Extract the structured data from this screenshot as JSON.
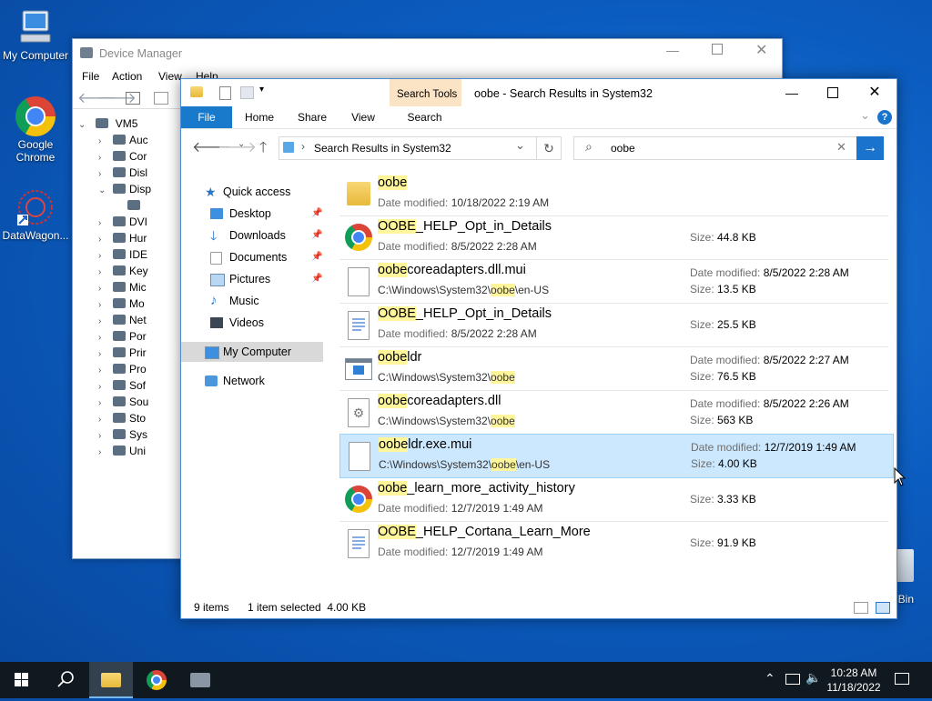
{
  "desktop": {
    "icons": [
      {
        "label": "My Computer"
      },
      {
        "label": "Google Chrome"
      },
      {
        "label": "DataWagon..."
      },
      {
        "label": "Bin"
      }
    ]
  },
  "device_manager": {
    "title": "Device Manager",
    "menu": [
      "File",
      "Action",
      "View",
      "Help"
    ],
    "tree_root": "VM5",
    "tree_items": [
      "Auc",
      "Cor",
      "Disl",
      "Disp",
      "",
      "DVI",
      "Hur",
      "IDE",
      "Key",
      "Mic",
      "Mo",
      "Net",
      "Por",
      "Prir",
      "Pro",
      "Sof",
      "Sou",
      "Sto",
      "Sys",
      "Uni"
    ]
  },
  "explorer": {
    "title": "oobe - Search Results in System32",
    "search_tools_label": "Search Tools",
    "tabs": {
      "file": "File",
      "home": "Home",
      "share": "Share",
      "view": "View",
      "search": "Search"
    },
    "address": "Search Results in System32",
    "search_query": "oobe",
    "nav": {
      "quick_access": "Quick access",
      "items": [
        "Desktop",
        "Downloads",
        "Documents",
        "Pictures",
        "Music",
        "Videos"
      ],
      "my_computer": "My Computer",
      "network": "Network"
    },
    "files": [
      {
        "hl": "oobe",
        "rest": "",
        "line2_key": "Date modified: ",
        "line2_val": "10/18/2022 2:19 AM",
        "icon": "folder-icon"
      },
      {
        "hl": "OOBE",
        "rest": "_HELP_Opt_in_Details",
        "line2_key": "Date modified: ",
        "line2_val": "8/5/2022 2:28 AM",
        "size_key": "Size: ",
        "size": "44.8 KB",
        "icon": "chrome-html-icon"
      },
      {
        "hl": "oobe",
        "rest": "coreadapters.dll.mui",
        "path_a": "C:\\Windows\\System32\\",
        "path_hl": "oobe",
        "path_b": "\\en-US",
        "date_key": "Date modified: ",
        "date": "8/5/2022 2:28 AM",
        "size_key": "Size: ",
        "size": "13.5 KB",
        "icon": "file-icon"
      },
      {
        "hl": "OOBE",
        "rest": "_HELP_Opt_in_Details",
        "line2_key": "Date modified: ",
        "line2_val": "8/5/2022 2:28 AM",
        "size_key": "Size: ",
        "size": "25.5 KB",
        "icon": "text-document-icon"
      },
      {
        "hl": "oobe",
        "rest": "ldr",
        "path_a": "C:\\Windows\\System32\\",
        "path_hl": "oobe",
        "path_b": "",
        "date_key": "Date modified: ",
        "date": "8/5/2022 2:27 AM",
        "size_key": "Size: ",
        "size": "76.5 KB",
        "icon": "application-icon"
      },
      {
        "hl": "oobe",
        "rest": "coreadapters.dll",
        "path_a": "C:\\Windows\\System32\\",
        "path_hl": "oobe",
        "path_b": "",
        "date_key": "Date modified: ",
        "date": "8/5/2022 2:26 AM",
        "size_key": "Size: ",
        "size": "563 KB",
        "icon": "dll-gear-icon"
      },
      {
        "hl": "oobe",
        "rest": "ldr.exe.mui",
        "path_a": "C:\\Windows\\System32\\",
        "path_hl": "oobe",
        "path_b": "\\en-US",
        "date_key": "Date modified: ",
        "date": "12/7/2019 1:49 AM",
        "size_key": "Size: ",
        "size": "4.00 KB",
        "icon": "file-icon",
        "selected": true
      },
      {
        "hl": "oobe",
        "rest": "_learn_more_activity_history",
        "line2_key": "Date modified: ",
        "line2_val": "12/7/2019 1:49 AM",
        "size_key": "Size: ",
        "size": "3.33 KB",
        "icon": "chrome-html-icon"
      },
      {
        "hl": "OOBE",
        "rest": "_HELP_Cortana_Learn_More",
        "line2_key": "Date modified: ",
        "line2_val": "12/7/2019 1:49 AM",
        "size_key": "Size: ",
        "size": "91.9 KB",
        "icon": "text-document-icon"
      }
    ],
    "status": {
      "count": "9 items",
      "selected": "1 item selected  4.00 KB"
    }
  },
  "taskbar": {
    "time": "10:28 AM",
    "date": "11/18/2022"
  }
}
